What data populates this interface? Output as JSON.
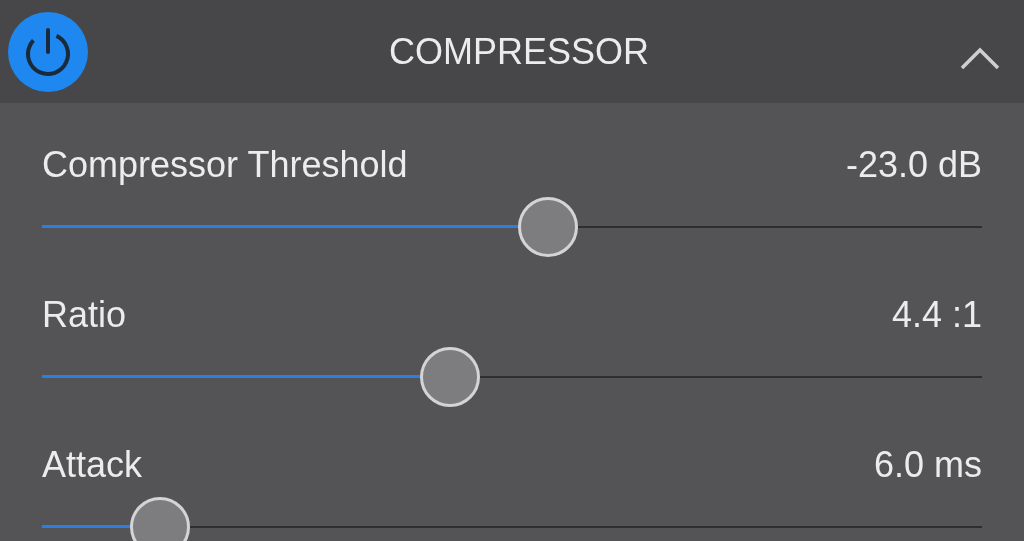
{
  "header": {
    "title": "COMPRESSOR",
    "power_on": true,
    "expanded": true
  },
  "parameters": [
    {
      "label": "Compressor Threshold",
      "value": "-23.0 dB",
      "level": 0.538
    },
    {
      "label": "Ratio",
      "value": "4.4 :1",
      "level": 0.434
    },
    {
      "label": "Attack",
      "value": "6.0 ms",
      "level": 0.126
    }
  ]
}
